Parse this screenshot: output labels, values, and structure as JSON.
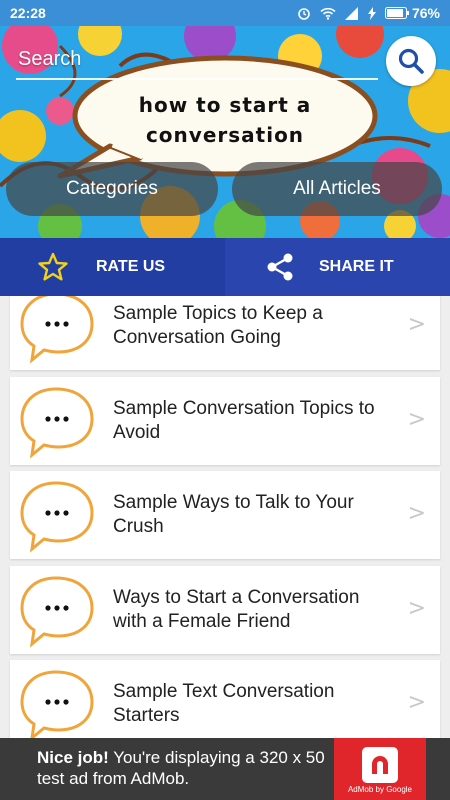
{
  "status_bar": {
    "time": "22:28",
    "battery_percent": "76%",
    "icons": [
      "alarm-icon",
      "wifi-icon",
      "signal-icon",
      "charging-icon",
      "battery-icon"
    ]
  },
  "header": {
    "search_label": "Search",
    "banner_text_line1": "how to start a",
    "banner_text_line2": "conversation",
    "tabs": [
      {
        "label": "Categories"
      },
      {
        "label": "All Articles"
      }
    ]
  },
  "actions": {
    "rate_label": "RATE US",
    "share_label": "SHARE IT",
    "rate_icon": "star-icon",
    "share_icon": "share-icon"
  },
  "articles": [
    {
      "line1": "Sample Topics to Keep a",
      "line2": "Conversation Going"
    },
    {
      "line1": "Sample Conversation Topics to",
      "line2": "Avoid"
    },
    {
      "line1": "Sample Ways to Talk to Your",
      "line2": "Crush"
    },
    {
      "line1": "Ways to Start a Conversation",
      "line2": "with a Female Friend"
    },
    {
      "line1": "Sample Text Conversation",
      "line2": "Starters"
    }
  ],
  "chevron": ">",
  "ad": {
    "headline": "Nice job!",
    "body": " You're displaying a 320 x 50 test ad from AdMob.",
    "logo_caption": "AdMob by Google"
  },
  "colors": {
    "status_bar": "#3a8fd6",
    "banner_sky": "#2aa6e8",
    "action_rate": "#233ea3",
    "action_share": "#2a45ad",
    "accent_orange": "#f0a43a",
    "ad_red": "#e0262b"
  }
}
